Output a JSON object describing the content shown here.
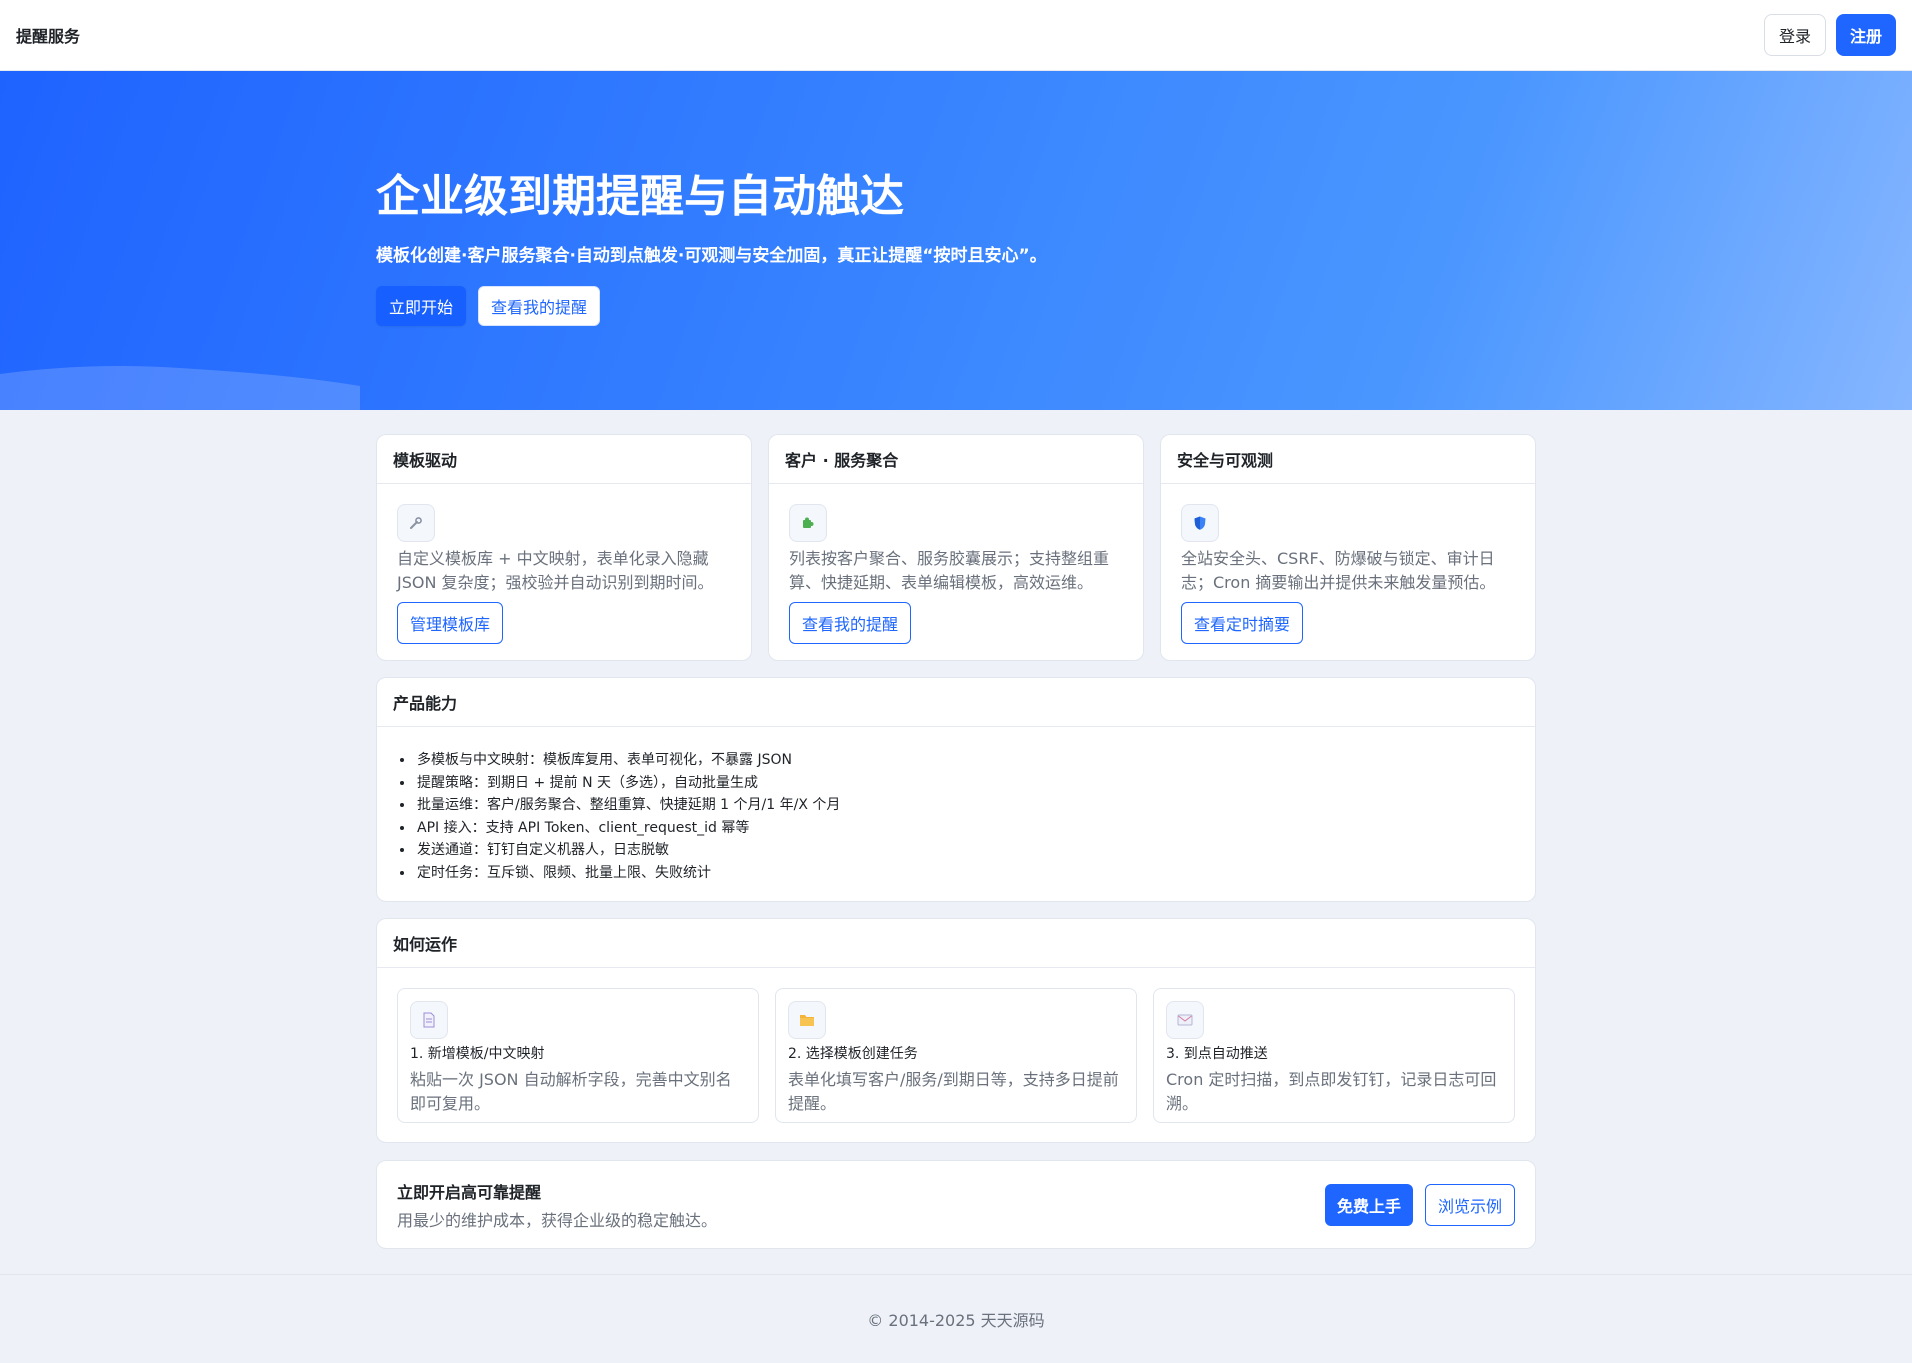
{
  "header": {
    "brand": "提醒服务",
    "login_label": "登录",
    "register_label": "注册"
  },
  "hero": {
    "title": "企业级到期提醒与自动触达",
    "subtitle": "模板化创建·客户服务聚合·自动到点触发·可观测与安全加固，真正让提醒“按时且安心”。",
    "primary_label": "立即开始",
    "secondary_label": "查看我的提醒"
  },
  "features": [
    {
      "title": "模板驱动",
      "icon": "wrench-icon",
      "desc": "自定义模板库 + 中文映射，表单化录入隐藏 JSON 复杂度；强校验并自动识别到期时间。",
      "button": "管理模板库"
    },
    {
      "title": "客户 · 服务聚合",
      "icon": "puzzle-icon",
      "desc": "列表按客户聚合、服务胶囊展示；支持整组重算、快捷延期、表单编辑模板，高效运维。",
      "button": "查看我的提醒"
    },
    {
      "title": "安全与可观测",
      "icon": "shield-icon",
      "desc": "全站安全头、CSRF、防爆破与锁定、审计日志；Cron 摘要输出并提供未来触发量预估。",
      "button": "查看定时摘要"
    }
  ],
  "capabilities": {
    "title": "产品能力",
    "items": [
      "多模板与中文映射：模板库复用、表单可视化，不暴露 JSON",
      "提醒策略：到期日 + 提前 N 天（多选），自动批量生成",
      "批量运维：客户/服务聚合、整组重算、快捷延期 1 个月/1 年/X 个月",
      "API 接入：支持 API Token、client_request_id 幂等",
      "发送通道：钉钉自定义机器人，日志脱敏",
      "定时任务：互斥锁、限频、批量上限、失败统计"
    ]
  },
  "how": {
    "title": "如何运作",
    "steps": [
      {
        "icon": "document-icon",
        "title": "1. 新增模板/中文映射",
        "desc": "粘贴一次 JSON 自动解析字段，完善中文别名即可复用。"
      },
      {
        "icon": "folder-icon",
        "title": "2. 选择模板创建任务",
        "desc": "表单化填写客户/服务/到期日等，支持多日提前提醒。"
      },
      {
        "icon": "envelope-icon",
        "title": "3. 到点自动推送",
        "desc": "Cron 定时扫描，到点即发钉钉，记录日志可回溯。"
      }
    ]
  },
  "cta": {
    "title": "立即开启高可靠提醒",
    "subtitle": "用最少的维护成本，获得企业级的稳定触达。",
    "primary_label": "免费上手",
    "secondary_label": "浏览示例"
  },
  "footer": {
    "copyright": "© 2014-2025 天天源码"
  },
  "colors": {
    "accent": "#1e66ff",
    "hero_gradient_start": "#1f63ff",
    "hero_gradient_end": "#86b6ff",
    "page_bg": "#eef2f8"
  }
}
